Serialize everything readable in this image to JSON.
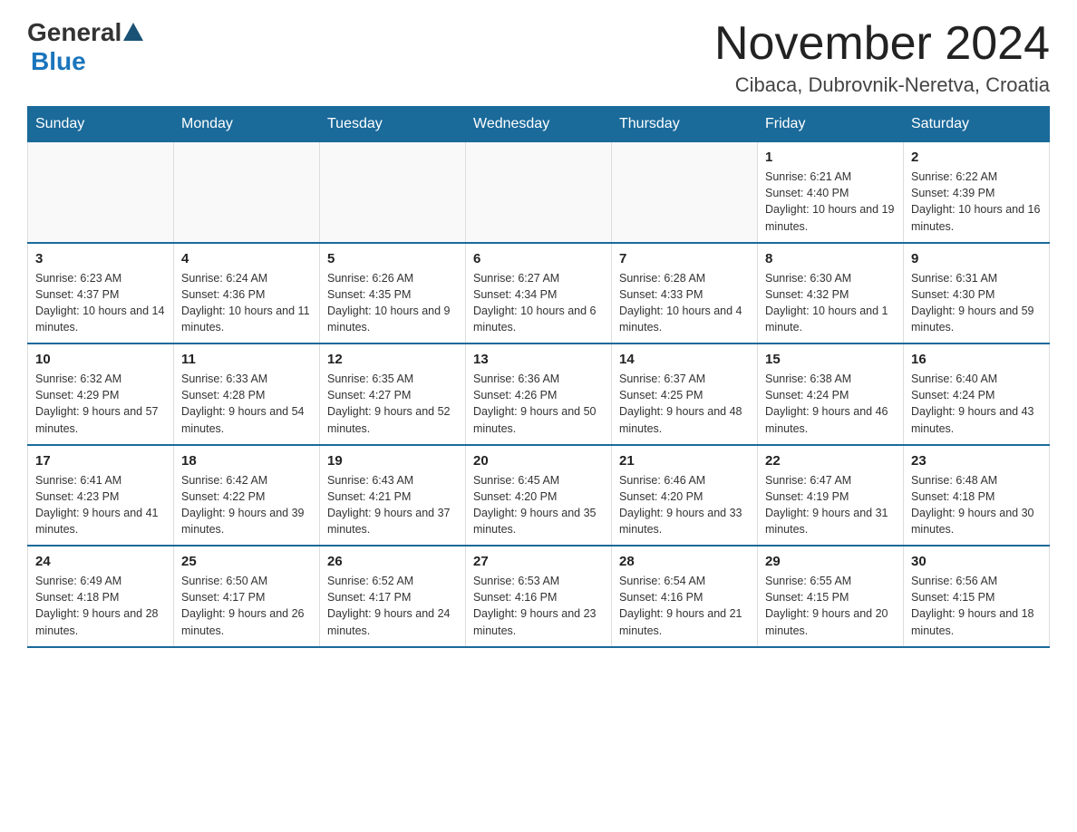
{
  "logo": {
    "general": "General",
    "triangle": "",
    "blue": "Blue"
  },
  "title": "November 2024",
  "subtitle": "Cibaca, Dubrovnik-Neretva, Croatia",
  "days_header": [
    "Sunday",
    "Monday",
    "Tuesday",
    "Wednesday",
    "Thursday",
    "Friday",
    "Saturday"
  ],
  "weeks": [
    [
      {
        "day": "",
        "info": ""
      },
      {
        "day": "",
        "info": ""
      },
      {
        "day": "",
        "info": ""
      },
      {
        "day": "",
        "info": ""
      },
      {
        "day": "",
        "info": ""
      },
      {
        "day": "1",
        "info": "Sunrise: 6:21 AM\nSunset: 4:40 PM\nDaylight: 10 hours and 19 minutes."
      },
      {
        "day": "2",
        "info": "Sunrise: 6:22 AM\nSunset: 4:39 PM\nDaylight: 10 hours and 16 minutes."
      }
    ],
    [
      {
        "day": "3",
        "info": "Sunrise: 6:23 AM\nSunset: 4:37 PM\nDaylight: 10 hours and 14 minutes."
      },
      {
        "day": "4",
        "info": "Sunrise: 6:24 AM\nSunset: 4:36 PM\nDaylight: 10 hours and 11 minutes."
      },
      {
        "day": "5",
        "info": "Sunrise: 6:26 AM\nSunset: 4:35 PM\nDaylight: 10 hours and 9 minutes."
      },
      {
        "day": "6",
        "info": "Sunrise: 6:27 AM\nSunset: 4:34 PM\nDaylight: 10 hours and 6 minutes."
      },
      {
        "day": "7",
        "info": "Sunrise: 6:28 AM\nSunset: 4:33 PM\nDaylight: 10 hours and 4 minutes."
      },
      {
        "day": "8",
        "info": "Sunrise: 6:30 AM\nSunset: 4:32 PM\nDaylight: 10 hours and 1 minute."
      },
      {
        "day": "9",
        "info": "Sunrise: 6:31 AM\nSunset: 4:30 PM\nDaylight: 9 hours and 59 minutes."
      }
    ],
    [
      {
        "day": "10",
        "info": "Sunrise: 6:32 AM\nSunset: 4:29 PM\nDaylight: 9 hours and 57 minutes."
      },
      {
        "day": "11",
        "info": "Sunrise: 6:33 AM\nSunset: 4:28 PM\nDaylight: 9 hours and 54 minutes."
      },
      {
        "day": "12",
        "info": "Sunrise: 6:35 AM\nSunset: 4:27 PM\nDaylight: 9 hours and 52 minutes."
      },
      {
        "day": "13",
        "info": "Sunrise: 6:36 AM\nSunset: 4:26 PM\nDaylight: 9 hours and 50 minutes."
      },
      {
        "day": "14",
        "info": "Sunrise: 6:37 AM\nSunset: 4:25 PM\nDaylight: 9 hours and 48 minutes."
      },
      {
        "day": "15",
        "info": "Sunrise: 6:38 AM\nSunset: 4:24 PM\nDaylight: 9 hours and 46 minutes."
      },
      {
        "day": "16",
        "info": "Sunrise: 6:40 AM\nSunset: 4:24 PM\nDaylight: 9 hours and 43 minutes."
      }
    ],
    [
      {
        "day": "17",
        "info": "Sunrise: 6:41 AM\nSunset: 4:23 PM\nDaylight: 9 hours and 41 minutes."
      },
      {
        "day": "18",
        "info": "Sunrise: 6:42 AM\nSunset: 4:22 PM\nDaylight: 9 hours and 39 minutes."
      },
      {
        "day": "19",
        "info": "Sunrise: 6:43 AM\nSunset: 4:21 PM\nDaylight: 9 hours and 37 minutes."
      },
      {
        "day": "20",
        "info": "Sunrise: 6:45 AM\nSunset: 4:20 PM\nDaylight: 9 hours and 35 minutes."
      },
      {
        "day": "21",
        "info": "Sunrise: 6:46 AM\nSunset: 4:20 PM\nDaylight: 9 hours and 33 minutes."
      },
      {
        "day": "22",
        "info": "Sunrise: 6:47 AM\nSunset: 4:19 PM\nDaylight: 9 hours and 31 minutes."
      },
      {
        "day": "23",
        "info": "Sunrise: 6:48 AM\nSunset: 4:18 PM\nDaylight: 9 hours and 30 minutes."
      }
    ],
    [
      {
        "day": "24",
        "info": "Sunrise: 6:49 AM\nSunset: 4:18 PM\nDaylight: 9 hours and 28 minutes."
      },
      {
        "day": "25",
        "info": "Sunrise: 6:50 AM\nSunset: 4:17 PM\nDaylight: 9 hours and 26 minutes."
      },
      {
        "day": "26",
        "info": "Sunrise: 6:52 AM\nSunset: 4:17 PM\nDaylight: 9 hours and 24 minutes."
      },
      {
        "day": "27",
        "info": "Sunrise: 6:53 AM\nSunset: 4:16 PM\nDaylight: 9 hours and 23 minutes."
      },
      {
        "day": "28",
        "info": "Sunrise: 6:54 AM\nSunset: 4:16 PM\nDaylight: 9 hours and 21 minutes."
      },
      {
        "day": "29",
        "info": "Sunrise: 6:55 AM\nSunset: 4:15 PM\nDaylight: 9 hours and 20 minutes."
      },
      {
        "day": "30",
        "info": "Sunrise: 6:56 AM\nSunset: 4:15 PM\nDaylight: 9 hours and 18 minutes."
      }
    ]
  ]
}
